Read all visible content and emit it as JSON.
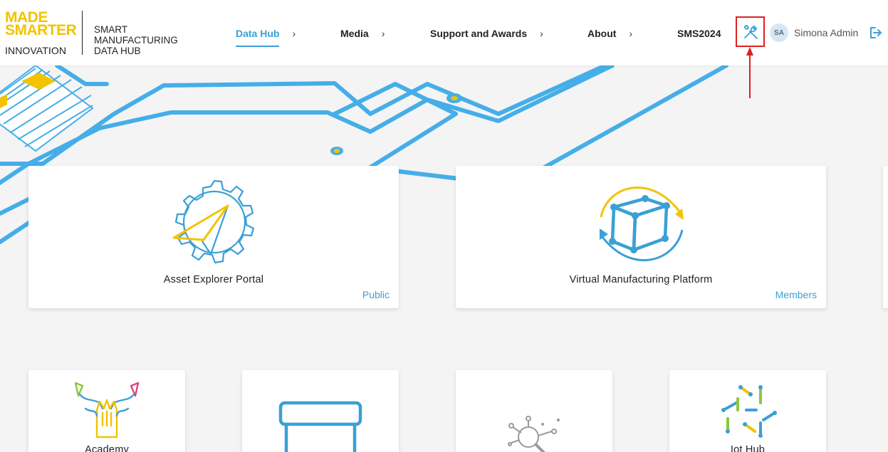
{
  "logo": {
    "made": "MADE",
    "smarter": "SMARTER",
    "innovation": "INNOVATION",
    "subtitle_lines": [
      "SMART",
      "MANUFACTURING",
      "DATA HUB"
    ]
  },
  "nav": [
    {
      "label": "Data Hub",
      "chevron": "›",
      "active": true
    },
    {
      "label": "Media",
      "chevron": "›"
    },
    {
      "label": "Support and Awards",
      "chevron": "›"
    },
    {
      "label": "About",
      "chevron": "›"
    },
    {
      "label": "SMS2024"
    }
  ],
  "tools_icon": "wrench-screwdriver-icon",
  "user": {
    "initials": "SA",
    "name": "Simona Admin",
    "logout_icon": "logout-icon"
  },
  "cards": [
    {
      "title": "Asset Explorer Portal",
      "tag": "Public",
      "icon": "gear-paper-plane-icon"
    },
    {
      "title": "Virtual Manufacturing Platform",
      "tag": "Members",
      "icon": "cube-cycle-icon"
    },
    {
      "title": "Academy",
      "icon": "hands-together-icon"
    },
    {
      "title": "",
      "icon": "box-icon"
    },
    {
      "title": "",
      "icon": "magnifier-network-icon"
    },
    {
      "title": "Iot Hub",
      "icon": "iot-network-icon"
    }
  ],
  "colors": {
    "accent": "#3aa0d6",
    "brand_yellow": "#f2c300",
    "highlight_red": "#e02020"
  }
}
